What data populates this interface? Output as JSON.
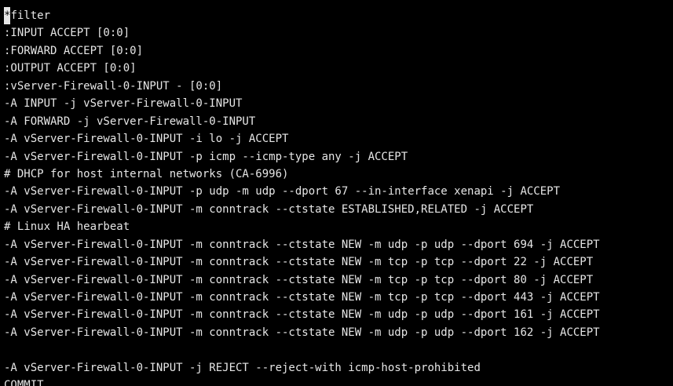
{
  "terminal": {
    "cursor_char": "*",
    "first_line_rest": "filter",
    "lines": [
      ":INPUT ACCEPT [0:0]",
      ":FORWARD ACCEPT [0:0]",
      ":OUTPUT ACCEPT [0:0]",
      ":vServer-Firewall-0-INPUT - [0:0]",
      "-A INPUT -j vServer-Firewall-0-INPUT",
      "-A FORWARD -j vServer-Firewall-0-INPUT",
      "-A vServer-Firewall-0-INPUT -i lo -j ACCEPT",
      "-A vServer-Firewall-0-INPUT -p icmp --icmp-type any -j ACCEPT",
      "# DHCP for host internal networks (CA-6996)",
      "-A vServer-Firewall-0-INPUT -p udp -m udp --dport 67 --in-interface xenapi -j ACCEPT",
      "-A vServer-Firewall-0-INPUT -m conntrack --ctstate ESTABLISHED,RELATED -j ACCEPT",
      "# Linux HA hearbeat",
      "-A vServer-Firewall-0-INPUT -m conntrack --ctstate NEW -m udp -p udp --dport 694 -j ACCEPT",
      "-A vServer-Firewall-0-INPUT -m conntrack --ctstate NEW -m tcp -p tcp --dport 22 -j ACCEPT",
      "-A vServer-Firewall-0-INPUT -m conntrack --ctstate NEW -m tcp -p tcp --dport 80 -j ACCEPT",
      "-A vServer-Firewall-0-INPUT -m conntrack --ctstate NEW -m tcp -p tcp --dport 443 -j ACCEPT",
      "-A vServer-Firewall-0-INPUT -m conntrack --ctstate NEW -m udp -p udp --dport 161 -j ACCEPT",
      "-A vServer-Firewall-0-INPUT -m conntrack --ctstate NEW -m udp -p udp --dport 162 -j ACCEPT",
      "",
      "-A vServer-Firewall-0-INPUT -j REJECT --reject-with icmp-host-prohibited",
      "COMMIT"
    ]
  },
  "colors": {
    "background": "#000000",
    "text": "#e6e6e6"
  }
}
